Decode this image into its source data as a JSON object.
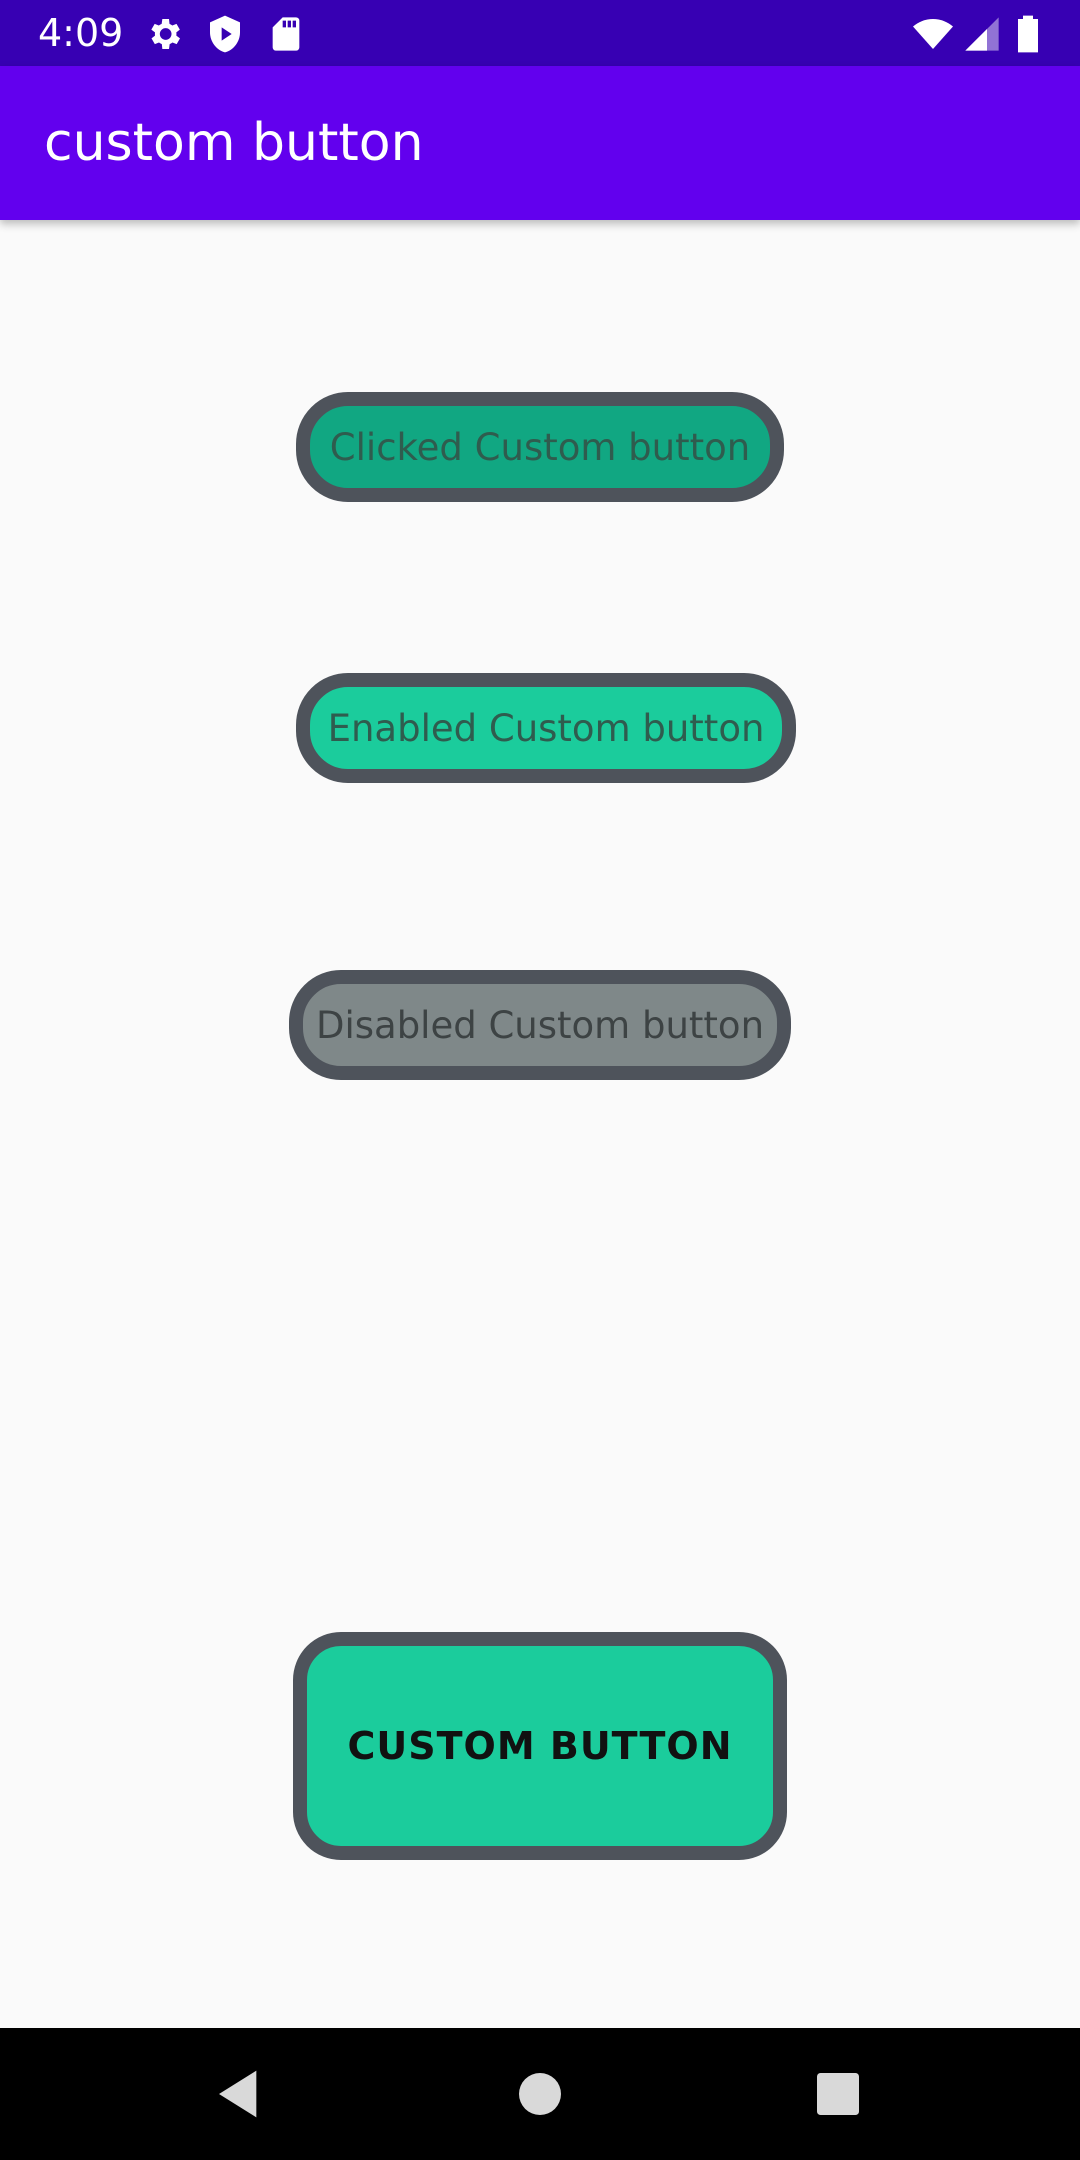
{
  "status_bar": {
    "time": "4:09",
    "left_icons": [
      "gear-icon",
      "shield-icon",
      "sd-card-icon"
    ],
    "right_icons": [
      "wifi-icon",
      "signal-icon",
      "battery-icon"
    ]
  },
  "app_bar": {
    "title": "custom button",
    "color": "#6200ee"
  },
  "buttons": {
    "clicked": {
      "label": "Clicked Custom button",
      "color": "#11a782"
    },
    "enabled": {
      "label": "Enabled Custom button",
      "color": "#1bcc9c"
    },
    "disabled": {
      "label": "Disabled Custom button",
      "color": "#7f8889"
    },
    "custom": {
      "label": "CUSTOM BUTTON",
      "color": "#1bcc9c"
    }
  },
  "nav_bar": {
    "icons": [
      "back-icon",
      "home-icon",
      "recents-icon"
    ]
  }
}
